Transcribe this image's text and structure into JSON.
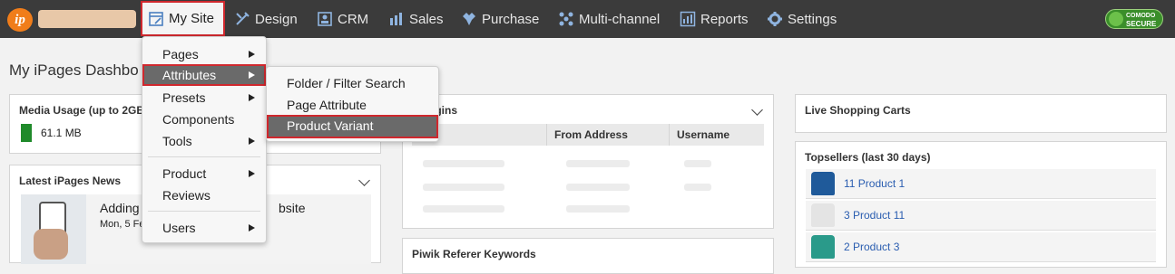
{
  "topbar": {
    "logo_text": "ip",
    "nav": [
      {
        "label": "My Site",
        "icon": "my-site-icon"
      },
      {
        "label": "Design",
        "icon": "design-icon"
      },
      {
        "label": "CRM",
        "icon": "crm-icon"
      },
      {
        "label": "Sales",
        "icon": "sales-icon"
      },
      {
        "label": "Purchase",
        "icon": "purchase-icon"
      },
      {
        "label": "Multi-channel",
        "icon": "multichannel-icon"
      },
      {
        "label": "Reports",
        "icon": "reports-icon"
      },
      {
        "label": "Settings",
        "icon": "gear-icon"
      }
    ],
    "badge": {
      "line1": "COMODO",
      "line2": "SECURE"
    }
  },
  "page": {
    "title": "My iPages Dashbo"
  },
  "mysite_menu": {
    "items": [
      "Pages",
      "Attributes",
      "Presets",
      "Components",
      "Tools",
      "Product",
      "Reviews",
      "Users"
    ]
  },
  "attributes_submenu": {
    "items": [
      "Folder / Filter Search",
      "Page Attribute",
      "Product Variant"
    ]
  },
  "media_usage": {
    "title": "Media Usage (up to 2GB",
    "value": "61.1 MB"
  },
  "news": {
    "title": "Latest iPages News",
    "headline_start": "Adding",
    "headline_end": "bsite",
    "date": "Mon, 5 Fe"
  },
  "logins": {
    "title": "n Logins",
    "columns": [
      "e",
      "From Address",
      "Username"
    ]
  },
  "piwik": {
    "title": "Piwik Referer Keywords"
  },
  "carts": {
    "title": "Live Shopping Carts"
  },
  "topsellers": {
    "title": "Topsellers (last 30 days)",
    "items": [
      {
        "label": "11 Product 1",
        "color": "#1f5a9a"
      },
      {
        "label": "3 Product 11",
        "color": "#e4e4e4"
      },
      {
        "label": "2 Product 3",
        "color": "#2a9a8a"
      }
    ]
  },
  "colors": {
    "accent_red": "#d0282e",
    "topbar": "#3b3b3b",
    "usage_bar": "#1f8a2a"
  }
}
